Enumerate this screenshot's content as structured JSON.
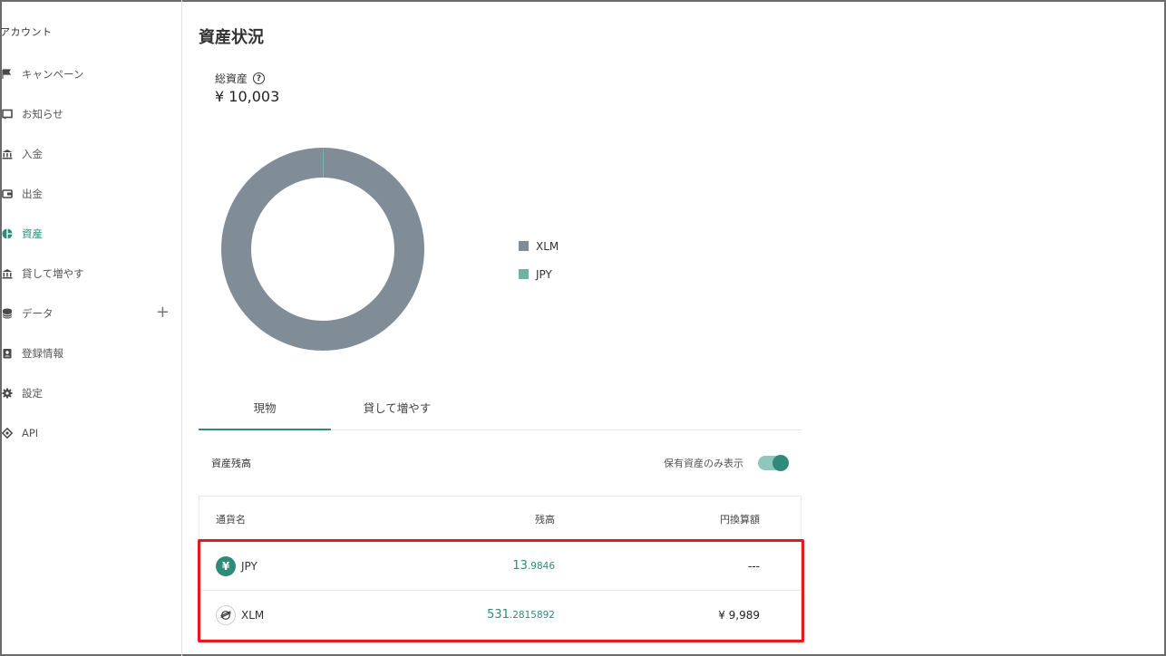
{
  "sidebar": {
    "section_label": "アカウント",
    "items": [
      {
        "label": "キャンペーン",
        "icon": "flag-icon"
      },
      {
        "label": "お知らせ",
        "icon": "message-icon"
      },
      {
        "label": "入金",
        "icon": "bank-icon"
      },
      {
        "label": "出金",
        "icon": "wallet-icon"
      },
      {
        "label": "資産",
        "icon": "pie-chart-icon",
        "active": true
      },
      {
        "label": "貸して増やす",
        "icon": "bank-icon"
      },
      {
        "label": "データ",
        "icon": "database-icon",
        "expand": "+"
      },
      {
        "label": "登録情報",
        "icon": "id-card-icon"
      },
      {
        "label": "設定",
        "icon": "gear-icon"
      },
      {
        "label": "API",
        "icon": "api-icon"
      }
    ]
  },
  "main": {
    "title": "資産状況",
    "total_label": "総資産",
    "total_value": "¥ 10,003",
    "help_icon": "?"
  },
  "chart_data": {
    "type": "pie",
    "donut": true,
    "categories": [
      "XLM",
      "JPY"
    ],
    "values": [
      9989,
      13.9846
    ],
    "colors": [
      "#808d97",
      "#6fb3a2"
    ],
    "legend_position": "right"
  },
  "tabs": [
    {
      "label": "現物",
      "active": true
    },
    {
      "label": "貸して増やす",
      "active": false
    }
  ],
  "holdings": {
    "title": "資産残高",
    "only_held_label": "保有資産のみ表示",
    "only_held_on": true,
    "columns": [
      "通貨名",
      "残高",
      "円換算額"
    ],
    "rows": [
      {
        "currency": "JPY",
        "icon": "¥",
        "balance_int": "13",
        "balance_frac": ".9846",
        "jpy": "---"
      },
      {
        "currency": "XLM",
        "icon": "⌀",
        "balance_int": "531",
        "balance_frac": ".2815892",
        "jpy": "¥ 9,989"
      }
    ]
  },
  "colors": {
    "accent": "#2e8b7a",
    "highlight": "#e41a1c",
    "xlm": "#808d97",
    "jpy": "#6fb3a2"
  }
}
